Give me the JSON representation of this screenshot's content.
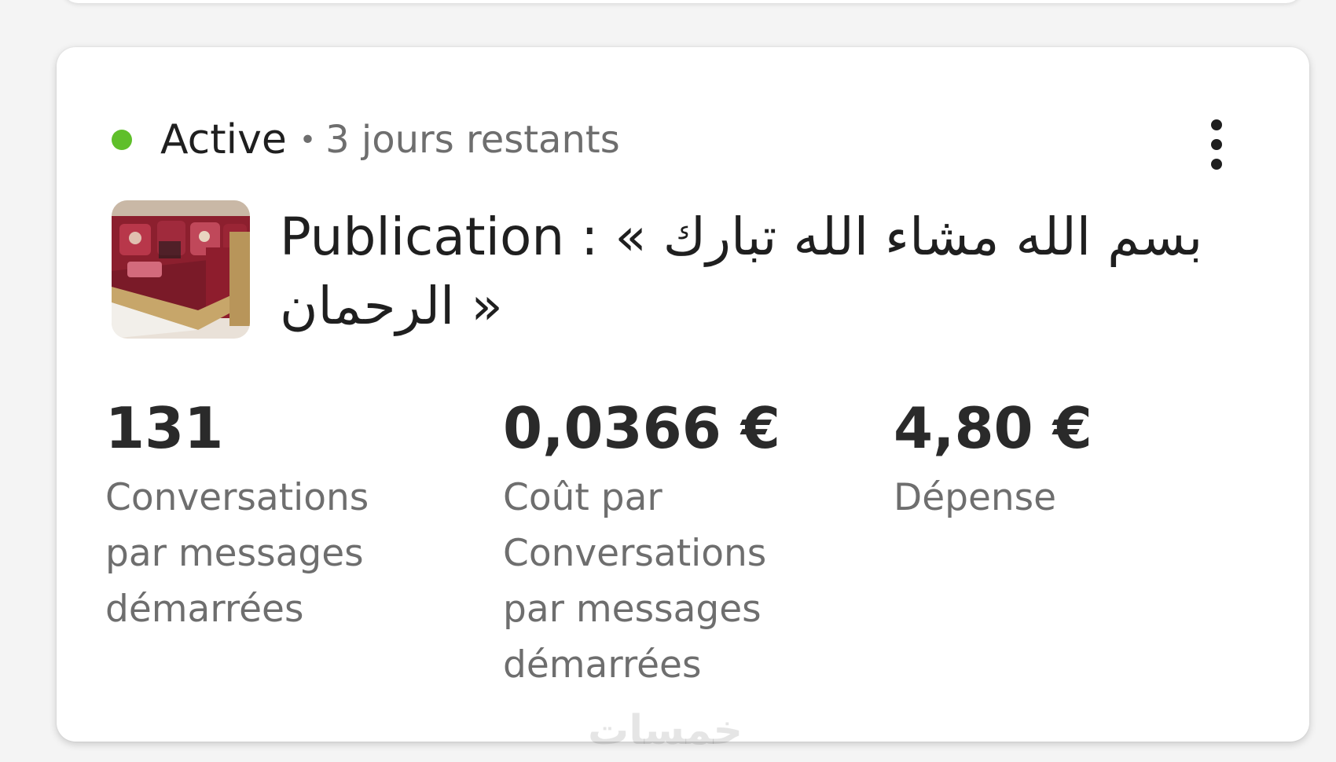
{
  "campaign": {
    "status": "Active",
    "separator": "•",
    "remaining": "3 jours restants",
    "status_color": "#5fbf2a",
    "more_icon": "more-vertical-icon"
  },
  "post": {
    "title_line1": "Publication : « بسم الله مشاء الله تبارك",
    "title_line2": "الرحمان »"
  },
  "metrics": [
    {
      "value": "131",
      "label_lines": [
        "Conversations",
        "par messages",
        "démarrées"
      ]
    },
    {
      "value": "0,0366 €",
      "label_lines": [
        "Coût par",
        "Conversations",
        "par messages",
        "démarrées"
      ]
    },
    {
      "value": "4,80 €",
      "label_lines": [
        "Dépense"
      ]
    }
  ],
  "watermark": "خمسات"
}
